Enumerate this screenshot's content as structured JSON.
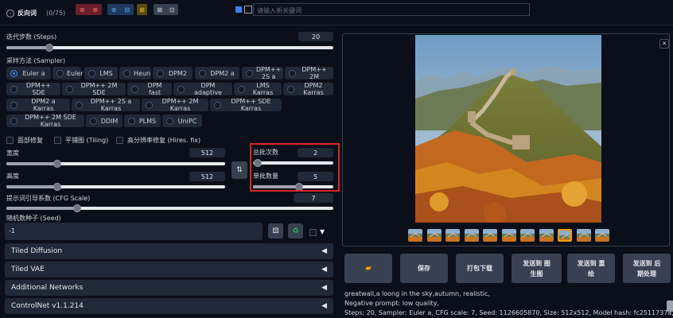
{
  "negative": {
    "title": "反向词",
    "count": "(0/75)",
    "search_placeholder": "请输入新关键词",
    "toolbar_glyphs": [
      "⊗",
      "⊕",
      "⊕",
      "⊟",
      "⊞",
      "⊠",
      "⊡"
    ]
  },
  "steps": {
    "label": "迭代步数 (Steps)",
    "value": "20",
    "fraction": 0.13
  },
  "sampler": {
    "label": "采样方法 (Sampler)",
    "selected": "Euler a",
    "options": [
      "Euler a",
      "Euler",
      "LMS",
      "Heun",
      "DPM2",
      "DPM2 a",
      "DPM++ 2S a",
      "DPM++ 2M",
      "DPM++ SDE",
      "DPM++ 2M SDE",
      "DPM fast",
      "DPM adaptive",
      "LMS Karras",
      "DPM2 Karras",
      "DPM2 a Karras",
      "DPM++ 2S a Karras",
      "DPM++ 2M Karras",
      "DPM++ SDE Karras",
      "DPM++ 2M SDE Karras",
      "DDIM",
      "PLMS",
      "UniPC"
    ]
  },
  "checkboxes": {
    "restore_faces": "面部修复",
    "tiling": "平铺图 (Tiling)",
    "hires": "高分辨率修复 (Hires. fix)"
  },
  "width": {
    "label": "宽度",
    "value": "512"
  },
  "height": {
    "label": "高度",
    "value": "512"
  },
  "batch_count": {
    "label": "总批次数",
    "value": "2"
  },
  "batch_size": {
    "label": "单批数量",
    "value": "5"
  },
  "cfg": {
    "label": "提示词引导系数 (CFG Scale)",
    "value": "7"
  },
  "seed": {
    "label": "随机数种子 (Seed)",
    "value": "-1"
  },
  "accordions": [
    "Tiled Diffusion",
    "Tiled VAE",
    "Additional Networks",
    "ControlNet v1.1.214"
  ],
  "actions": {
    "save": "保存",
    "zip": "打包下载",
    "send_img2img": "发送到 图\n生图",
    "send_inpaint": "发送到 重\n绘",
    "send_extras": "发送到 后\n期处理"
  },
  "info": {
    "prompt": "greatwall,a loong in the sky,autumn, realistic,",
    "negative": "Negative prompt: low quality,",
    "params": "Steps: 20, Sampler: Euler a, CFG scale: 7, Seed: 1126605870, Size: 512x512, Model hash: fc2511737a, Model:"
  },
  "colors": {
    "accent": "#3b82f6",
    "highlight": "#dc2626",
    "selected_thumb": "#f59e0b"
  }
}
